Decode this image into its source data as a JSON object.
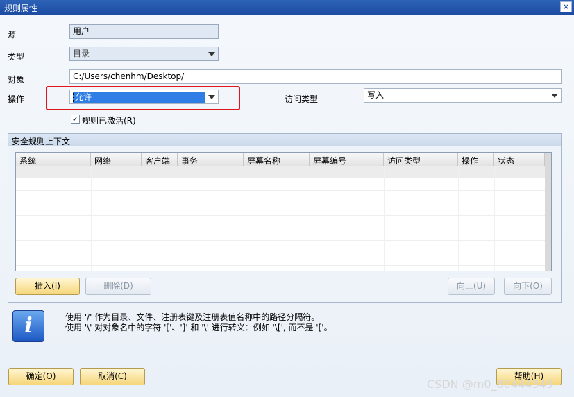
{
  "window": {
    "title": "规则属性",
    "close_symbol": "✕"
  },
  "form": {
    "source_label": "源",
    "source_value": "用户",
    "type_label": "类型",
    "type_value": "目录",
    "object_label": "对象",
    "object_value": "C:/Users/chenhm/Desktop/",
    "operation_label": "操作",
    "operation_value": "允许",
    "access_type_label": "访问类型",
    "access_type_value": "写入",
    "activated_label": "规则已激活(R)",
    "activated_checked": "✓"
  },
  "context_group": {
    "title": "安全规则上下文",
    "columns": [
      "系统",
      "网络",
      "客户端",
      "事务",
      "屏幕名称",
      "屏幕编号",
      "访问类型",
      "操作",
      "状态"
    ]
  },
  "buttons": {
    "insert": "插入(I)",
    "delete": "删除(D)",
    "up": "向上(U)",
    "down": "向下(O)",
    "ok": "确定(O)",
    "cancel": "取消(C)",
    "help": "帮助(H)"
  },
  "info": {
    "icon_glyph": "i",
    "line1": "使用 '/' 作为目录、文件、注册表键及注册表值名称中的路径分隔符。",
    "line2": "使用 '\\' 对对象名中的字符 '['、']' 和 '\\' 进行转义：例如 '\\[', 而不是 '['。"
  },
  "watermark": "CSDN @m0_60444349",
  "colors": {
    "highlight": "#e0161b",
    "selection": "#2f7ee6"
  }
}
